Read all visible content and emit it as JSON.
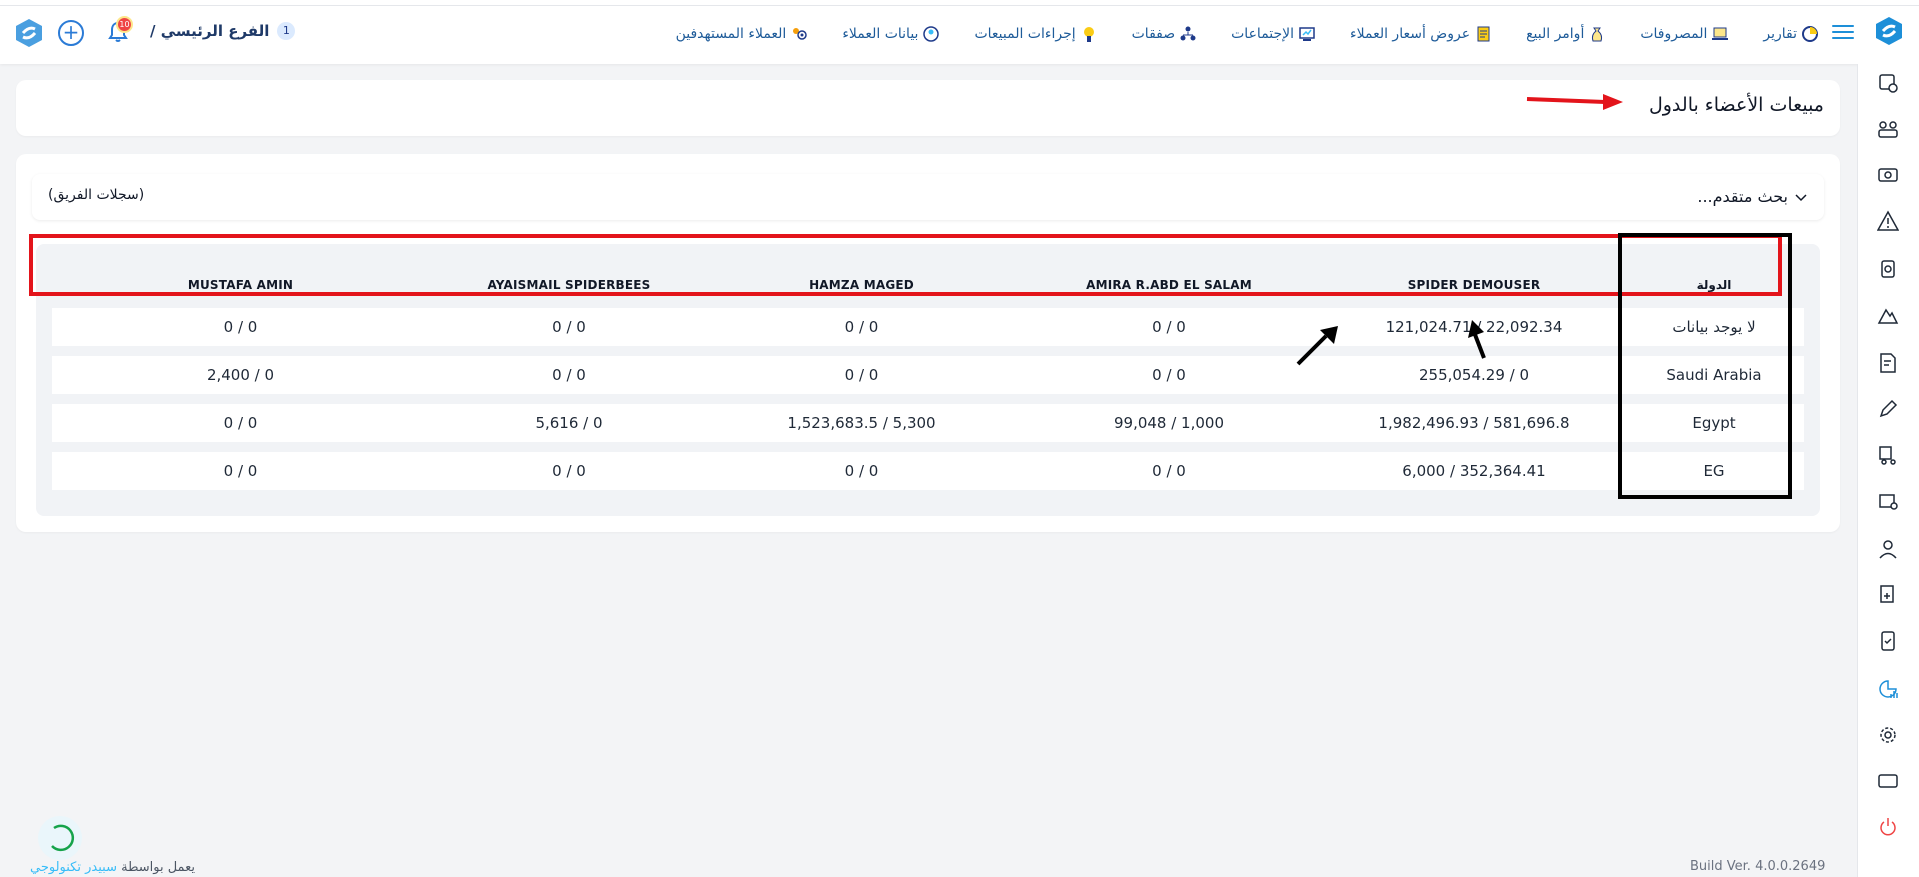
{
  "topbar": {
    "nav": [
      {
        "label": "العملاء المستهدفين",
        "icon": "target-customers-icon"
      },
      {
        "label": "بيانات العملاء",
        "icon": "customer-data-icon"
      },
      {
        "label": "إجراءات المبيعات",
        "icon": "sales-actions-icon"
      },
      {
        "label": "صفقات",
        "icon": "deals-icon"
      },
      {
        "label": "الإجتماعات",
        "icon": "meetings-icon"
      },
      {
        "label": "عروض أسعار العملاء",
        "icon": "quotations-icon"
      },
      {
        "label": "أوامر البيع",
        "icon": "sales-orders-icon"
      },
      {
        "label": "المصروفات",
        "icon": "expenses-icon"
      },
      {
        "label": "تقارير",
        "icon": "reports-icon"
      }
    ],
    "branch_label": "الفرع الرئيسي /",
    "branch_count": "1",
    "notification_count": "10"
  },
  "page": {
    "title": "مبيعات الأعضاء بالدول"
  },
  "filters": {
    "advanced_search": "بحث متقدم...",
    "team_records": "(سجلات الفريق)"
  },
  "table": {
    "headers": {
      "country": "الدولة",
      "member1": "SPIDER DEMOUSER",
      "member2": "AMIRA R.ABD EL SALAM",
      "member3": "HAMZA MAGED",
      "member4": "AYAISMAIL SPIDERBEES",
      "member5": "MUSTAFA AMIN"
    },
    "rows": [
      {
        "country": "لا يوجد بيانات",
        "m1": "121,024.71 / 22,092.34",
        "m2": "0 / 0",
        "m3": "0 / 0",
        "m4": "0 / 0",
        "m5": "0 / 0"
      },
      {
        "country": "Saudi Arabia",
        "m1": "255,054.29 / 0",
        "m2": "0 / 0",
        "m3": "0 / 0",
        "m4": "0 / 0",
        "m5": "2,400 / 0"
      },
      {
        "country": "Egypt",
        "m1": "1,982,496.93 / 581,696.8",
        "m2": "99,048 / 1,000",
        "m3": "1,523,683.5 / 5,300",
        "m4": "5,616 / 0",
        "m5": "0 / 0"
      },
      {
        "country": "EG",
        "m1": "6,000 / 352,364.41",
        "m2": "0 / 0",
        "m3": "0 / 0",
        "m4": "0 / 0",
        "m5": "0 / 0"
      }
    ]
  },
  "footer": {
    "powered_by": "يعمل بواسطة",
    "brand": "سبيدر تكنولوجي",
    "build": "Build Ver. 4.0.0.2649"
  },
  "colors": {
    "accent": "#1d8fd8",
    "highlight_red": "#e3141b",
    "highlight_black": "#000000"
  }
}
